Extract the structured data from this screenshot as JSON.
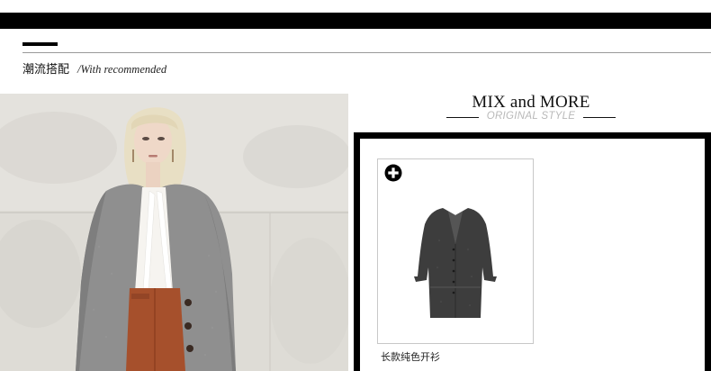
{
  "section": {
    "title_cn": "潮流搭配",
    "title_en": "/With recommended"
  },
  "mix": {
    "title": "MIX and MORE",
    "subtitle": "ORIGINAL STYLE"
  },
  "product": {
    "name": "长款纯色开衫",
    "add_icon": "plus-circle-icon"
  },
  "colors": {
    "bar": "#000000",
    "rule": "#999999",
    "subtitle": "#b9b9b9",
    "cardigan": "#8f8f8f",
    "skirt": "#a6502c"
  }
}
